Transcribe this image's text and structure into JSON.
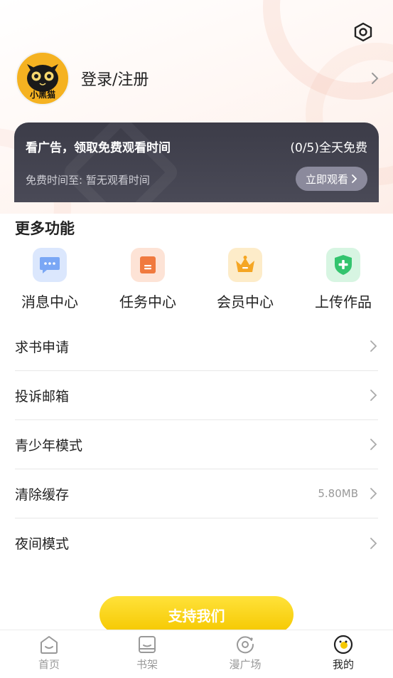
{
  "header": {
    "settings_icon": "settings-hexagon-icon"
  },
  "profile": {
    "avatar_text": "小黑猫",
    "login_label": "登录/注册"
  },
  "ad_card": {
    "title": "看广告，领取免费观看时间",
    "count": "(0/5)全天免费",
    "subtitle": "免费时间至: 暂无观看时间",
    "button_label": "立即观看"
  },
  "more_features": {
    "title": "更多功能",
    "items": [
      {
        "label": "消息中心",
        "icon": "message-icon",
        "color": "#7aa7f5"
      },
      {
        "label": "任务中心",
        "icon": "task-icon",
        "color": "#f07a3f"
      },
      {
        "label": "会员中心",
        "icon": "crown-icon",
        "color": "#f5a623"
      },
      {
        "label": "上传作品",
        "icon": "upload-icon",
        "color": "#33c46e"
      }
    ]
  },
  "menu": {
    "items": [
      {
        "label": "求书申请",
        "value": ""
      },
      {
        "label": "投诉邮箱",
        "value": ""
      },
      {
        "label": "青少年模式",
        "value": ""
      },
      {
        "label": "清除缓存",
        "value": "5.80MB"
      },
      {
        "label": "夜间模式",
        "value": ""
      }
    ]
  },
  "support_button": {
    "label": "支持我们"
  },
  "tabbar": {
    "items": [
      {
        "label": "首页",
        "icon": "home-icon"
      },
      {
        "label": "书架",
        "icon": "bookshelf-icon"
      },
      {
        "label": "漫广场",
        "icon": "comic-plaza-icon"
      },
      {
        "label": "我的",
        "icon": "profile-face-icon"
      }
    ],
    "active_index": 3
  },
  "colors": {
    "accent_yellow": "#f5c800",
    "ad_card_bg": "#3c3c48",
    "text_primary": "#222222",
    "text_secondary": "#999999"
  }
}
